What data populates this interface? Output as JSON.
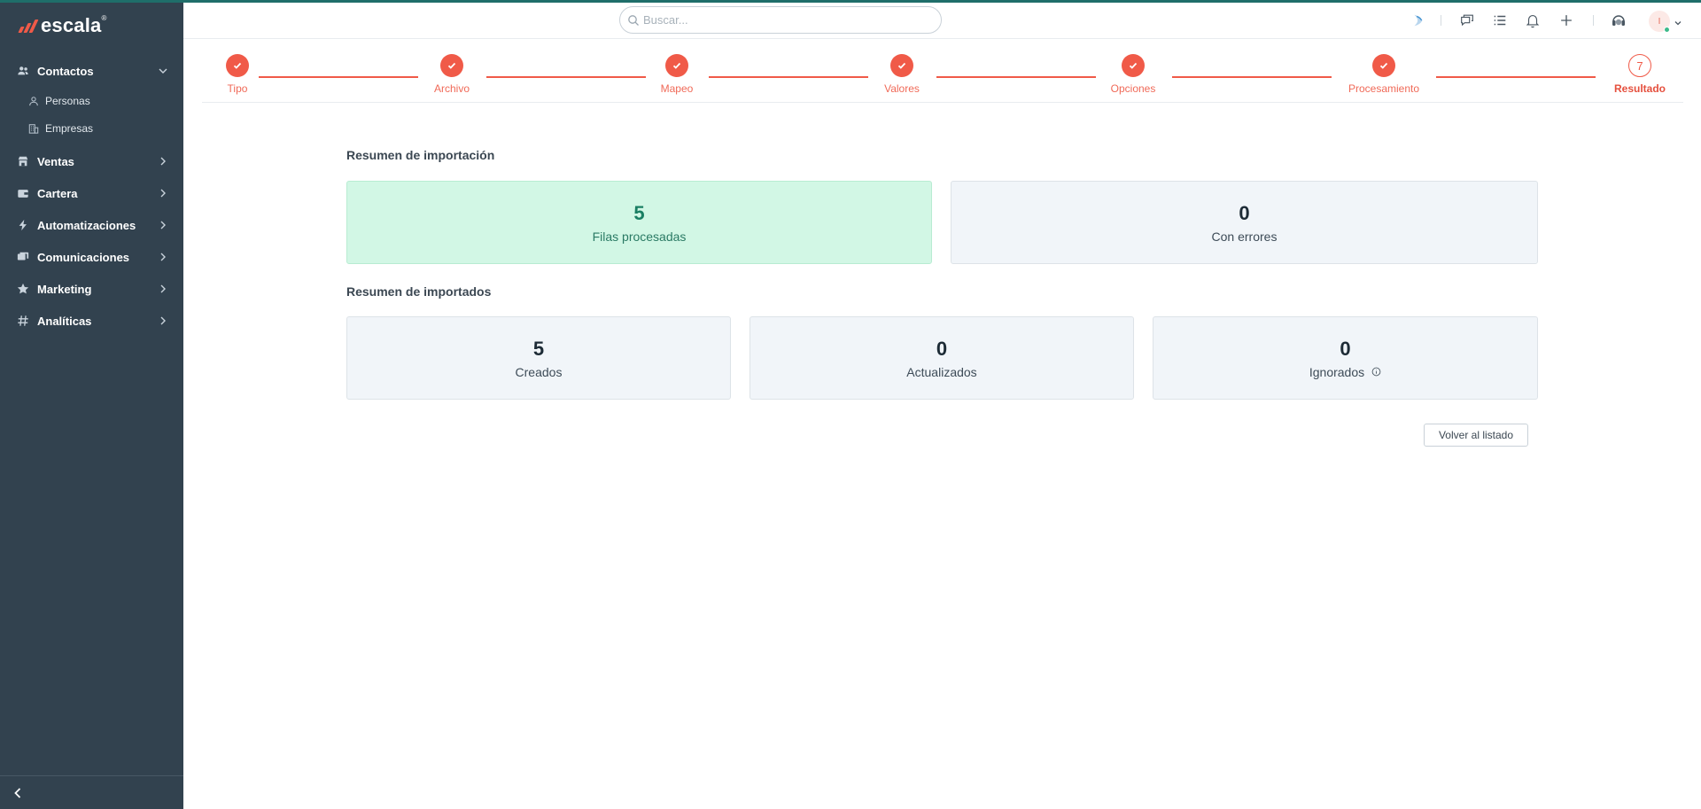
{
  "brand": {
    "name": "escala",
    "trademark": "®"
  },
  "sidebar": {
    "items": [
      {
        "label": "Contactos",
        "expanded": true,
        "children": [
          {
            "label": "Personas"
          },
          {
            "label": "Empresas"
          }
        ]
      },
      {
        "label": "Ventas"
      },
      {
        "label": "Cartera"
      },
      {
        "label": "Automatizaciones"
      },
      {
        "label": "Comunicaciones"
      },
      {
        "label": "Marketing"
      },
      {
        "label": "Analíticas"
      }
    ]
  },
  "header": {
    "search_placeholder": "Buscar...",
    "avatar_initial": "I",
    "icons": [
      "bird-icon",
      "chat-icon",
      "list-icon",
      "bell-icon",
      "plus-icon",
      "headset-icon"
    ]
  },
  "stepper": {
    "steps": [
      {
        "label": "Tipo",
        "done": true
      },
      {
        "label": "Archivo",
        "done": true
      },
      {
        "label": "Mapeo",
        "done": true
      },
      {
        "label": "Valores",
        "done": true
      },
      {
        "label": "Opciones",
        "done": true
      },
      {
        "label": "Procesamiento",
        "done": true
      },
      {
        "label": "Resultado",
        "done": false,
        "number": "7"
      }
    ]
  },
  "import_summary": {
    "title": "Resumen de importación",
    "processed": {
      "value": "5",
      "label": "Filas procesadas"
    },
    "errors": {
      "value": "0",
      "label": "Con errores"
    }
  },
  "imported_summary": {
    "title": "Resumen de importados",
    "created": {
      "value": "5",
      "label": "Creados"
    },
    "updated": {
      "value": "0",
      "label": "Actualizados"
    },
    "ignored": {
      "value": "0",
      "label": "Ignorados"
    }
  },
  "actions": {
    "back_label": "Volver al listado"
  },
  "colors": {
    "accent": "#f05a48",
    "sidebar": "#32424f",
    "success_bg": "#d2f7e5",
    "top_bar": "#1f6e6a"
  }
}
